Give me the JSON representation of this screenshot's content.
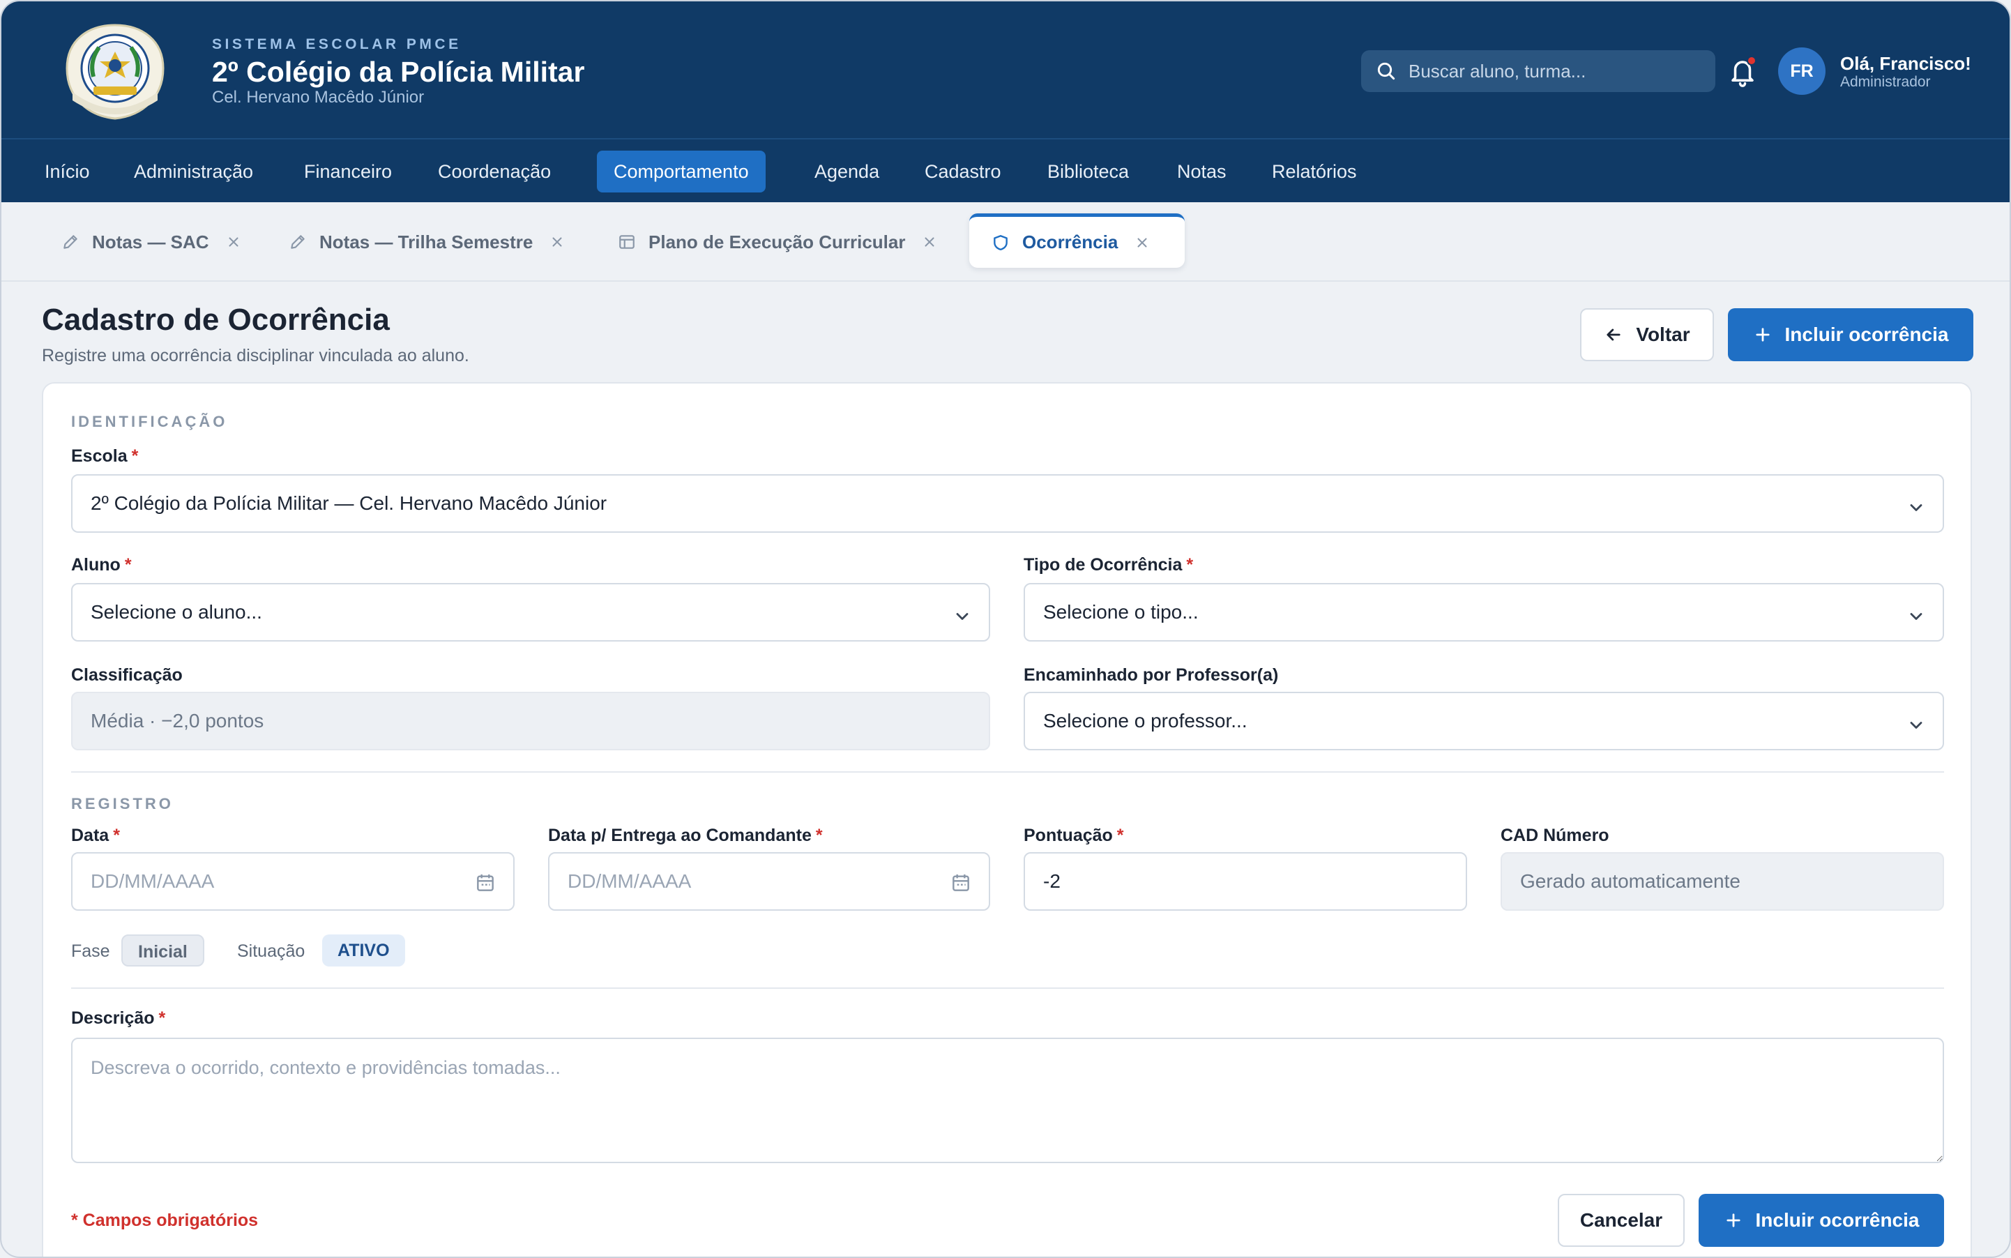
{
  "header": {
    "eyebrow": "SISTEMA ESCOLAR PMCE",
    "title": "2º Colégio da Polícia Militar",
    "subtitle": "Cel. Hervano Macêdo Júnior",
    "logo_text": "2º COLÉGIO DA POLÍCIA MILITAR",
    "search_placeholder": "Buscar aluno, turma...",
    "avatar_initials": "FR",
    "user_greeting": "Olá, Francisco!",
    "user_role": "Administrador"
  },
  "nav": {
    "items": [
      "Início",
      "Administração",
      "Financeiro",
      "Coordenação",
      "Comportamento",
      "Agenda",
      "Cadastro",
      "Biblioteca",
      "Notas",
      "Relatórios"
    ],
    "active": "Comportamento"
  },
  "tabs": [
    {
      "label": "Notas — SAC",
      "icon": "pencil-icon"
    },
    {
      "label": "Notas — Trilha Semestre",
      "icon": "pencil-icon"
    },
    {
      "label": "Plano de Execução Curricular",
      "icon": "layout-icon"
    },
    {
      "label": "Ocorrência",
      "icon": "shield-icon",
      "active": true
    }
  ],
  "page": {
    "title": "Cadastro de Ocorrência",
    "subtitle": "Registre uma ocorrência disciplinar vinculada ao aluno.",
    "back_label": "Voltar",
    "primary_label": "Incluir ocorrência"
  },
  "form": {
    "section_identificacao": "IDENTIFICAÇÃO",
    "escola_label": "Escola",
    "escola_value": "2º Colégio da Polícia Militar — Cel. Hervano Macêdo Júnior",
    "aluno_label": "Aluno",
    "aluno_placeholder": "Selecione o aluno...",
    "tipo_label": "Tipo de Ocorrência",
    "tipo_placeholder": "Selecione o tipo...",
    "classificacao_label": "Classificação",
    "classificacao_value": "Média · −2,0 pontos",
    "professor_label": "Encaminhado por Professor(a)",
    "professor_placeholder": "Selecione o professor...",
    "section_registro": "REGISTRO",
    "data_label": "Data",
    "data_placeholder": "DD/MM/AAAA",
    "data_entrega_label": "Data p/ Entrega ao Comandante",
    "data_entrega_placeholder": "DD/MM/AAAA",
    "pontuacao_label": "Pontuação",
    "pontuacao_value": "-2",
    "cad_label": "CAD Número",
    "cad_value": "Gerado automaticamente",
    "fase_label": "Fase",
    "fase_value": "Inicial",
    "situacao_label": "Situação",
    "situacao_value": "ATIVO",
    "descricao_label": "Descrição",
    "descricao_placeholder": "Descreva o ocorrido, contexto e providências tomadas...",
    "required_asterisk": "*",
    "required_note": "* Campos obrigatórios",
    "cancel_label": "Cancelar",
    "submit_label": "Incluir ocorrência"
  },
  "colors": {
    "header_bg": "#103a66",
    "accent": "#1f6fc4",
    "required": "#d0312d",
    "notification_dot": "#e0332f"
  }
}
